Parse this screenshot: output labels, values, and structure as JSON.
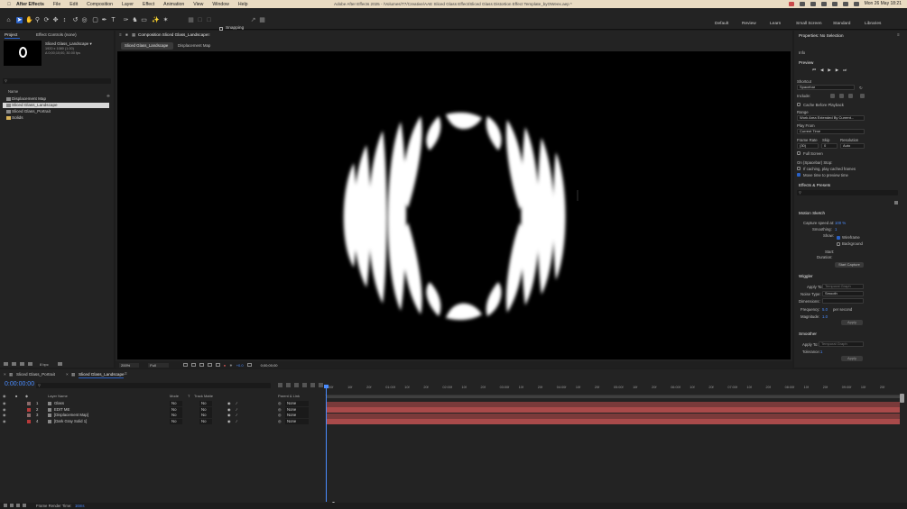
{
  "menubar": {
    "app": "After Effects",
    "items": [
      "File",
      "Edit",
      "Composition",
      "Layer",
      "Effect",
      "Animation",
      "View",
      "Window",
      "Help"
    ],
    "window_title": "Adobe After Effects 2025 - /Volumes/T7/Creative/AAE Sliced Glass Effect/Sliced Glass Distortion Effect Template_byOWeex.aep *",
    "clock": "Mon 26 May 18:21"
  },
  "toolbar": {
    "snapping_label": "Snapping",
    "workspaces": [
      "Default",
      "Review",
      "Learn",
      "Small Screen",
      "Standard",
      "Libraries"
    ]
  },
  "project": {
    "tab_project": "Project",
    "tab_effect_controls": "Effect Controls (none)",
    "selected_name": "Sliced Glass_Landscape ▾",
    "selected_info1": "1920 x 1080 (1.00)",
    "selected_info2": "Δ 0;00;10;00, 30.00 fps",
    "col_name": "Name",
    "items": [
      {
        "label": "Displacement Map",
        "color": "#8c8c8c",
        "selected": false
      },
      {
        "label": "Sliced Glass_Landscape",
        "color": "#8c8c8c",
        "selected": true
      },
      {
        "label": "Sliced Glass_Portrait",
        "color": "#8c8c8c",
        "selected": false
      },
      {
        "label": "Solids",
        "color": "#d8b25a",
        "selected": false
      }
    ],
    "bpc": "8 bpc"
  },
  "viewer": {
    "panel_title": "Composition Sliced Glass_Landscape",
    "tabs": [
      "Sliced Glass_Landscape",
      "Displacement Map"
    ],
    "zoom": "200%",
    "resolution": "Full",
    "exposure": "+0.0",
    "timecode": "0;00;00;00"
  },
  "properties": {
    "title": "Properties: No Selection",
    "info": "Info",
    "preview": "Preview",
    "shortcut_label": "Shortcut",
    "shortcut_value": "Spacebar",
    "include_label": "Include:",
    "cache_before_playback": "Cache Before Playback",
    "range_label": "Range",
    "range_value": "Work Area Extended By Current...",
    "play_from_label": "Play From",
    "play_from_value": "Current Time",
    "frame_rate_label": "Frame Rate",
    "skip_label": "Skip",
    "resolution_label": "Resolution",
    "frame_rate_value": "(30)",
    "skip_value": "0",
    "resolution_value": "Auto",
    "full_screen": "Full Screen",
    "on_stop_label": "On (Spacebar) Stop:",
    "if_caching": "If caching, play cached frames",
    "move_time": "Move time to preview time",
    "effects_presets": "Effects & Presets",
    "motion_sketch": "Motion Sketch",
    "capture_speed_label": "Capture speed at:",
    "capture_speed_value": "100 %",
    "smoothing_label": "Smoothing:",
    "smoothing_value": "1",
    "show_label": "Show:",
    "wireframe": "Wireframe",
    "background": "Background",
    "start_label": "Start:",
    "duration_label": "Duration:",
    "start_capture": "Start Capture",
    "wiggler": "Wiggler",
    "apply_to_label": "Apply To:",
    "apply_to_value": "Temporal Graph",
    "noise_type_label": "Noise Type:",
    "noise_type_value": "Smooth",
    "dimensions_label": "Dimensions:",
    "frequency_label": "Frequency:",
    "frequency_value": "5.0",
    "per_second": "per second",
    "magnitude_label": "Magnitude:",
    "magnitude_value": "1.0",
    "apply": "Apply",
    "smoother": "Smoother",
    "tolerance_label": "Tolerance:",
    "tolerance_value": "1"
  },
  "timeline": {
    "tabs": [
      "Sliced Glass_Portrait",
      "Sliced Glass_Landscape"
    ],
    "timecode": "0:00:00:00",
    "col_layer_name": "Layer Name",
    "col_mode": "Mode",
    "col_t": "T",
    "col_track_matte": "Track Matte",
    "col_parent": "Parent & Link",
    "layers": [
      {
        "num": "1",
        "name": "Glass",
        "color": "#8a6b6b",
        "mode": "No",
        "parent": "None"
      },
      {
        "num": "2",
        "name": "EDIT ME",
        "color": "#b83a3a",
        "mode": "No",
        "parent": "None"
      },
      {
        "num": "3",
        "name": "[Displacement Map]",
        "color": "#8a6b6b",
        "mode": "No",
        "parent": "None"
      },
      {
        "num": "4",
        "name": "[Dark Gray Solid 1]",
        "color": "#b83a3a",
        "mode": "No",
        "parent": "None"
      }
    ],
    "ruler": [
      "00f",
      "10f",
      "20f",
      "01:00f",
      "10f",
      "20f",
      "02:00f",
      "10f",
      "20f",
      "03:00f",
      "10f",
      "20f",
      "04:00f",
      "10f",
      "20f",
      "05:00f",
      "10f",
      "20f",
      "06:00f",
      "10f",
      "20f",
      "07:00f",
      "10f",
      "20f",
      "08:00f",
      "10f",
      "20f",
      "09:00f",
      "10f",
      "20f"
    ],
    "frame_render_label": "Frame Render Time:",
    "frame_render_value": "16ms"
  },
  "colors": {
    "accent": "#2a61c5",
    "timecode": "#4a8cff",
    "layer_bar_red": "#a94a4a",
    "layer_bar_dark": "#7a3a3a"
  }
}
